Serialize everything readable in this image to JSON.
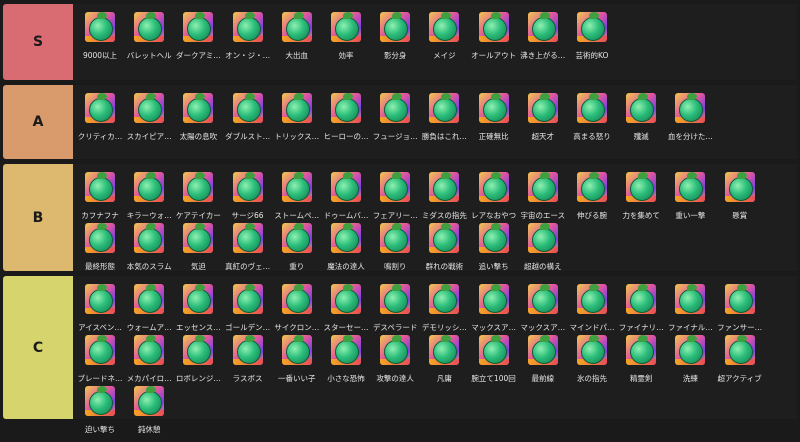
{
  "tiers": [
    {
      "label": "S",
      "color": "#d96b72",
      "items": [
        "9000以上",
        "バレットヘル",
        "ダークアミ…",
        "オン・ジ・…",
        "大出血",
        "効率",
        "影分身",
        "メイジ",
        "オールアウト",
        "沸き上がる…",
        "芸術的KO"
      ]
    },
    {
      "label": "A",
      "color": "#d99a6c",
      "items": [
        "クリティカ…",
        "スカイピア…",
        "太陽の息吹",
        "ダブルスト…",
        "トリックス…",
        "ヒーローの…",
        "フュージョ…",
        "勝負はこれ…",
        "正確無比",
        "超天才",
        "高まる怒り",
        "殲滅",
        "血を分けた…"
      ]
    },
    {
      "label": "B",
      "color": "#dcb96e",
      "items": [
        "カフナフナ",
        "キラーウォ…",
        "ケアテイカー",
        "サージ66",
        "ストームペ…",
        "ドゥームバ…",
        "フェアリー…",
        "ミダスの指先",
        "レアなおやつ",
        "宇宙のエース",
        "伸びる腕",
        "力を集めて",
        "重い一撃",
        "懸賞",
        "最終形態",
        "本気のスラム",
        "気迫",
        "真紅のヴェ…",
        "重り",
        "魔法の達人",
        "鳴割り",
        "群れの戦術",
        "追い撃ち",
        "超越の構え"
      ]
    },
    {
      "label": "C",
      "color": "#d6d56d",
      "items": [
        "アイスベン…",
        "ウォームア…",
        "エッセンス…",
        "ゴールデン…",
        "サイクロン…",
        "スターセー…",
        "デスペラード",
        "デモリッシ…",
        "マックスア…",
        "マックスア…",
        "マインドパ…",
        "ファイナリ…",
        "ファイナル…",
        "ファンサー…",
        "ブレードネ…",
        "メカパイロ…",
        "ロボレンジ…",
        "ラスボス",
        "一番いい子",
        "小さな恐怖",
        "攻撃の達人",
        "凡庸",
        "腕立て100回",
        "最前線",
        "氷の指先",
        "精霊剣",
        "洗練",
        "超アクティブ",
        "迫い撃ち",
        "鈍休憩"
      ]
    }
  ]
}
